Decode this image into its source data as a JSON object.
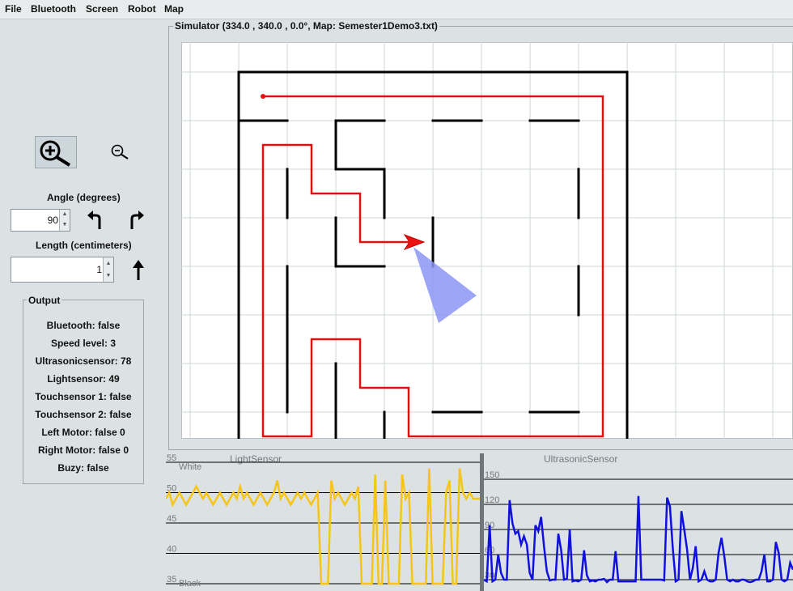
{
  "menu": [
    "File",
    "Bluetooth",
    "Screen",
    "Robot",
    "Map"
  ],
  "zoom": {
    "in_icon": "zoom-in-icon",
    "out_icon": "zoom-out-icon"
  },
  "angle": {
    "label": "Angle (degrees)",
    "value": "90"
  },
  "length": {
    "label": "Length (centimeters)",
    "value": "1"
  },
  "output": {
    "title": "Output",
    "rows": [
      "Bluetooth: false",
      "Speed level: 3",
      "Ultrasonicsensor: 78",
      "Lightsensor: 49",
      "Touchsensor 1: false",
      "Touchsensor 2: false",
      "Left Motor: false 0",
      "Right Motor: false 0",
      "Buzy: false"
    ]
  },
  "simulator": {
    "title": "Simulator (334.0 , 340.0 , 0.0°, Map: Semester1Demo3.txt)"
  },
  "colors": {
    "wall": "#000000",
    "path": "#e01010",
    "robot": "#ee1111",
    "sonar": "#8c95f5",
    "light": "#f5c518",
    "ultra": "#1010e0"
  },
  "chart_data": [
    {
      "type": "line",
      "title": "LightSensor",
      "ylim": [
        35,
        55
      ],
      "yticks": [
        35,
        40,
        45,
        50,
        55
      ],
      "annotations": [
        "White",
        "Black"
      ],
      "series": [
        {
          "values": [
            49,
            50,
            48,
            49,
            50,
            49,
            48,
            49,
            50,
            51,
            50,
            49,
            50,
            49,
            48,
            49,
            50,
            49,
            48,
            49,
            50,
            49,
            51,
            49,
            50,
            49,
            48,
            49,
            50,
            49,
            48,
            49,
            50,
            52,
            49,
            50,
            49,
            48,
            49,
            50,
            49,
            50,
            49,
            48,
            49,
            50,
            35,
            35,
            35,
            52,
            49,
            50,
            49,
            48,
            49,
            50,
            49,
            51,
            35,
            35,
            35,
            35,
            53,
            35,
            35,
            52,
            35,
            35,
            35,
            35,
            53,
            49,
            50,
            35,
            35,
            35,
            35,
            35,
            54,
            35,
            35,
            35,
            35,
            50,
            52,
            35,
            35,
            54,
            50,
            49,
            50,
            49,
            49,
            49
          ]
        }
      ]
    },
    {
      "type": "line",
      "title": "UltrasonicSensor",
      "ylim": [
        30,
        150
      ],
      "yticks": [
        30,
        60,
        90,
        120,
        150
      ],
      "series": [
        {
          "values": [
            30,
            28,
            95,
            28,
            30,
            60,
            38,
            30,
            30,
            125,
            97,
            85,
            88,
            72,
            82,
            72,
            38,
            30,
            95,
            88,
            105,
            70,
            40,
            29,
            30,
            30,
            85,
            65,
            30,
            31,
            90,
            28,
            29,
            28,
            30,
            65,
            35,
            28,
            29,
            28,
            30,
            30,
            31,
            27,
            30,
            30,
            64,
            28,
            28,
            28,
            28,
            28,
            28,
            28,
            130,
            30,
            30,
            30,
            30,
            30,
            30,
            30,
            30,
            29,
            128,
            118,
            68,
            28,
            30,
            112,
            90,
            66,
            30,
            44,
            70,
            28,
            30,
            40,
            30,
            28,
            28,
            30,
            62,
            80,
            58,
            30,
            28,
            30,
            28,
            28,
            30,
            30,
            28,
            27,
            28,
            30,
            30,
            40,
            60,
            28,
            28,
            30,
            75,
            62,
            30,
            28,
            30,
            50,
            42
          ]
        }
      ]
    }
  ]
}
